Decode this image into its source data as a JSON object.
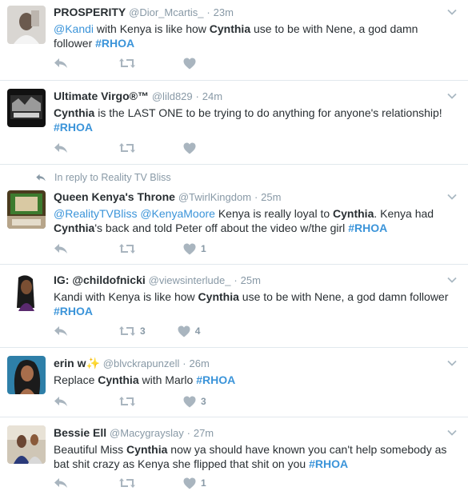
{
  "tweets": [
    {
      "name": "PROSPERITY",
      "handle": "@Dior_Mcartis_",
      "time": "23m",
      "parts": [
        {
          "t": "mention",
          "v": "@Kandi"
        },
        {
          "t": "text",
          "v": " with Kenya is like how "
        },
        {
          "t": "bold",
          "v": "Cynthia"
        },
        {
          "t": "text",
          "v": " use to be with Nene, a god damn follower "
        },
        {
          "t": "hashtag",
          "v": "#RHOA"
        }
      ],
      "retweet_count": "",
      "like_count": ""
    },
    {
      "name": "Ultimate Virgo®™",
      "handle": "@lild829",
      "time": "24m",
      "parts": [
        {
          "t": "bold",
          "v": "Cynthia"
        },
        {
          "t": "text",
          "v": " is the LAST ONE to be trying to do anything for anyone's relationship! "
        },
        {
          "t": "hashtag",
          "v": "#RHOA"
        }
      ],
      "retweet_count": "",
      "like_count": ""
    },
    {
      "reply_context": "In reply to Reality TV Bliss",
      "name": "Queen Kenya's Throne",
      "handle": "@TwirlKingdom",
      "time": "25m",
      "parts": [
        {
          "t": "mention",
          "v": "@RealityTVBliss"
        },
        {
          "t": "text",
          "v": " "
        },
        {
          "t": "mention",
          "v": "@KenyaMoore"
        },
        {
          "t": "text",
          "v": " Kenya is really loyal to "
        },
        {
          "t": "bold",
          "v": "Cynthia"
        },
        {
          "t": "text",
          "v": ". Kenya had "
        },
        {
          "t": "bold",
          "v": "Cynthia"
        },
        {
          "t": "text",
          "v": "'s back and told Peter off about the video w/the girl "
        },
        {
          "t": "hashtag",
          "v": "#RHOA"
        }
      ],
      "retweet_count": "",
      "like_count": "1"
    },
    {
      "name": "IG: @childofnicki",
      "handle": "@viewsinterlude_",
      "time": "25m",
      "parts": [
        {
          "t": "text",
          "v": "Kandi with Kenya is like how "
        },
        {
          "t": "bold",
          "v": "Cynthia"
        },
        {
          "t": "text",
          "v": " use to be with Nene, a god damn follower "
        },
        {
          "t": "hashtag",
          "v": "#RHOA"
        }
      ],
      "retweet_count": "3",
      "like_count": "4"
    },
    {
      "name": "erin w✨",
      "handle": "@blvckrapunzell",
      "time": "26m",
      "parts": [
        {
          "t": "text",
          "v": "Replace "
        },
        {
          "t": "bold",
          "v": "Cynthia"
        },
        {
          "t": "text",
          "v": " with Marlo "
        },
        {
          "t": "hashtag",
          "v": "#RHOA"
        }
      ],
      "retweet_count": "",
      "like_count": "3"
    },
    {
      "name": "Bessie Ell",
      "handle": "@Macygrayslay",
      "time": "27m",
      "parts": [
        {
          "t": "text",
          "v": "Beautiful Miss "
        },
        {
          "t": "bold",
          "v": "Cynthia"
        },
        {
          "t": "text",
          "v": " now ya should have known you can't help somebody as bat shit crazy as Kenya she flipped that shit on you  "
        },
        {
          "t": "hashtag",
          "v": "#RHOA"
        }
      ],
      "retweet_count": "",
      "like_count": "1"
    }
  ],
  "dot": "·",
  "icons": {
    "reply": "reply-icon",
    "retweet": "retweet-icon",
    "like": "heart-icon",
    "more": "chevron-down-icon",
    "reply_context": "reply-arrow-icon"
  },
  "colors": {
    "link": "#3b94d9",
    "muted": "#8899a6",
    "icon": "#a9b5bf",
    "border": "#e1e8ed"
  }
}
